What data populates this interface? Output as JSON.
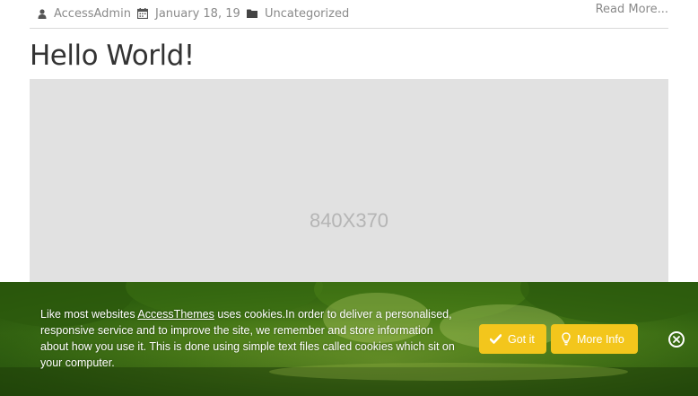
{
  "meta": {
    "author": "AccessAdmin",
    "date": "January 18, 19",
    "category": "Uncategorized",
    "read_more": "Read More..."
  },
  "post": {
    "title": "Hello World!",
    "image_label": "840X370"
  },
  "cookie_banner": {
    "text_before_link": "Like most websites ",
    "link_text": "AccessThemes",
    "text_after_link": " uses cookies.In order to deliver a personalised, responsive service and to improve the site, we remember and store information about how you use it. This is done using simple text files called cookies which sit on your computer.",
    "got_it_label": "Got it",
    "more_info_label": "More Info",
    "button_color": "#f3c61c"
  },
  "icons": {
    "author": "user-icon",
    "date": "calendar-icon",
    "category": "folder-icon",
    "got_it": "check-icon",
    "more_info": "lightbulb-icon",
    "close": "close-circle-icon"
  }
}
